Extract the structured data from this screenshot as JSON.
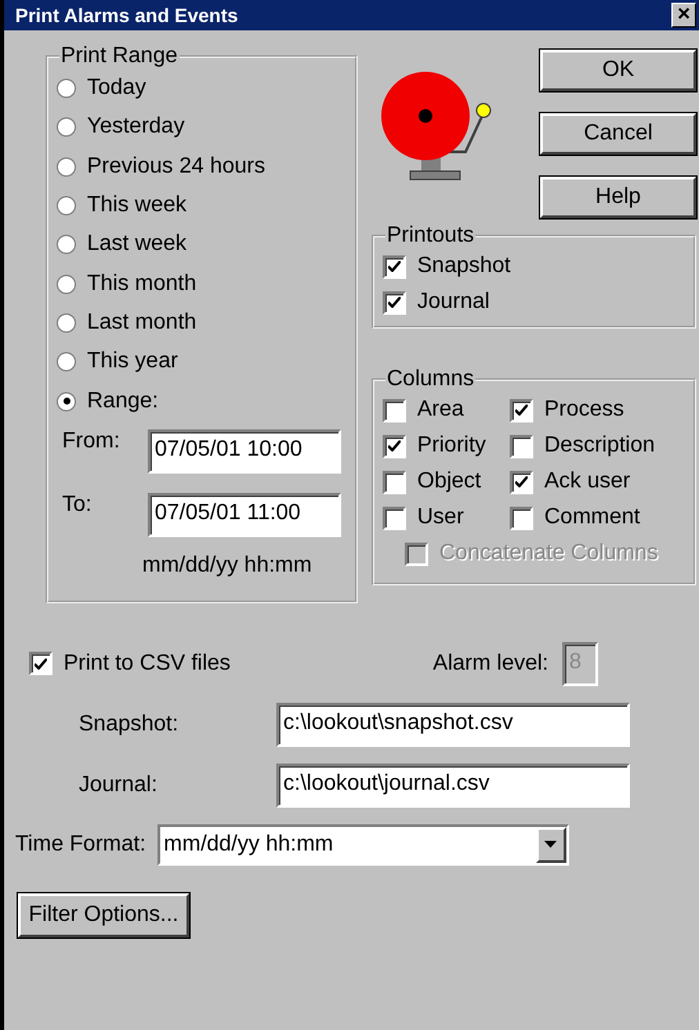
{
  "window": {
    "title": "Print Alarms and Events",
    "close": "×"
  },
  "print_range": {
    "title": "Print Range",
    "options": [
      {
        "label": "Today",
        "selected": false
      },
      {
        "label": "Yesterday",
        "selected": false
      },
      {
        "label": "Previous 24 hours",
        "selected": false
      },
      {
        "label": "This week",
        "selected": false
      },
      {
        "label": "Last week",
        "selected": false
      },
      {
        "label": "This month",
        "selected": false
      },
      {
        "label": "Last month",
        "selected": false
      },
      {
        "label": "This year",
        "selected": false
      },
      {
        "label": "Range:",
        "selected": true
      }
    ],
    "from_label": "From:",
    "from": "07/05/01 10:00",
    "to_label": "To:",
    "to": "07/05/01 11:00",
    "format_hint": "mm/dd/yy hh:mm"
  },
  "buttons": [
    "OK",
    "Cancel",
    "Help"
  ],
  "printouts": {
    "title": "Printouts",
    "items": [
      {
        "label": "Snapshot",
        "checked": true
      },
      {
        "label": "Journal",
        "checked": true
      }
    ]
  },
  "columns": {
    "title": "Columns",
    "items": [
      {
        "label": "Area",
        "checked": false
      },
      {
        "label": "Process",
        "checked": true
      },
      {
        "label": "Priority",
        "checked": true
      },
      {
        "label": "Description",
        "checked": false
      },
      {
        "label": "Object",
        "checked": false
      },
      {
        "label": "Ack user",
        "checked": true
      },
      {
        "label": "User",
        "checked": false
      },
      {
        "label": "Comment",
        "checked": false
      }
    ],
    "concatenate": {
      "label": "Concatenate Columns",
      "checked": false,
      "disabled": true
    }
  },
  "csv": {
    "label": "Print to CSV files",
    "checked": true,
    "alarm_level_label": "Alarm level:",
    "alarm_level": "8",
    "alarm_level_disabled": true,
    "snapshot_label": "Snapshot:",
    "snapshot": "c:\\lookout\\snapshot.csv",
    "journal_label": "Journal:",
    "journal": "c:\\lookout\\journal.csv"
  },
  "time_format": {
    "label": "Time Format:",
    "value": "mm/dd/yy hh:mm"
  },
  "filter_button": "Filter Options..."
}
